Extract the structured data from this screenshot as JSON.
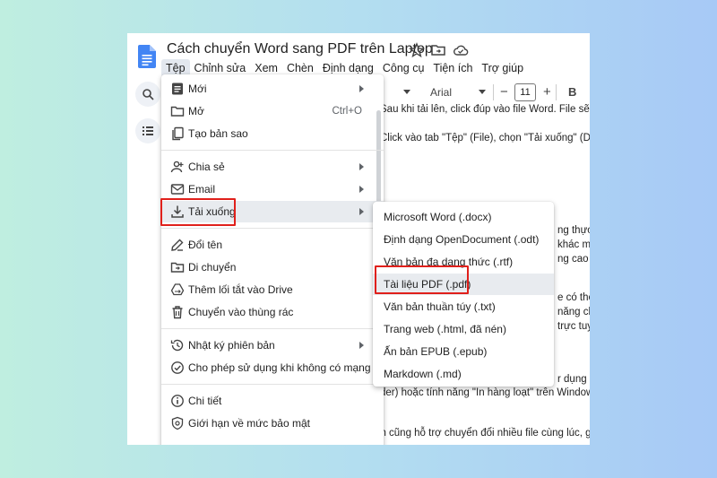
{
  "doc": {
    "title": "Cách chuyển Word sang PDF trên Laptop"
  },
  "menubar": [
    "Tệp",
    "Chỉnh sửa",
    "Xem",
    "Chèn",
    "Định dạng",
    "Công cụ",
    "Tiện ích",
    "Trợ giúp"
  ],
  "toolbar": {
    "font": "Arial",
    "font_size": "11",
    "minus": "−",
    "plus": "+",
    "bold": "B"
  },
  "body_lines": [
    "Sau khi tải lên, click đúp vào file Word. File sẽ đ",
    "Click vào tab \"Tệp\" (File), chọn \"Tải xuống\" (Do",
    "ng thực h",
    "khác mà",
    "ng cao n",
    "e có thể c",
    "năng ch",
    "trực tuyế",
    "r dụng p",
    "der) hoặc tính năng \"In hàng loạt\" trên Window",
    "Ngoài ra, một số công cụ trực tuyến cũng hỗ trợ chuyển đổi nhiều file cùng lúc, giú"
  ],
  "file_menu": {
    "items": [
      {
        "label": "Mới",
        "icon": "new-doc-icon",
        "arrow": true
      },
      {
        "label": "Mở",
        "icon": "folder-open-icon",
        "shortcut": "Ctrl+O"
      },
      {
        "label": "Tạo bản sao",
        "icon": "copy-icon"
      },
      {
        "label": "Chia sẻ",
        "icon": "share-person-icon",
        "arrow": true
      },
      {
        "label": "Email",
        "icon": "mail-icon",
        "arrow": true
      },
      {
        "label": "Tải xuống",
        "icon": "download-icon",
        "arrow": true
      },
      {
        "label": "Đổi tên",
        "icon": "rename-icon"
      },
      {
        "label": "Di chuyển",
        "icon": "move-folder-icon"
      },
      {
        "label": "Thêm lối tắt vào Drive",
        "icon": "drive-shortcut-icon"
      },
      {
        "label": "Chuyển vào thùng rác",
        "icon": "trash-icon"
      },
      {
        "label": "Nhật ký phiên bản",
        "icon": "history-icon",
        "arrow": true
      },
      {
        "label": "Cho phép sử dụng khi không có mạng",
        "icon": "offline-icon"
      },
      {
        "label": "Chi tiết",
        "icon": "info-icon"
      },
      {
        "label": "Giới hạn về mức bảo mật",
        "icon": "security-limit-icon"
      }
    ]
  },
  "download_submenu": {
    "items": [
      "Microsoft Word (.docx)",
      "Định dạng OpenDocument (.odt)",
      "Văn bản đa dạng thức (.rtf)",
      "Tài liệu PDF (.pdf)",
      "Văn bản thuần túy (.txt)",
      "Trang web (.html, đã nén)",
      "Ấn bản EPUB (.epub)",
      "Markdown (.md)"
    ]
  },
  "colors": {
    "highlight_box": "#e0201b",
    "docs_blue": "#4285f4",
    "hover_bg": "#e8ebef"
  }
}
